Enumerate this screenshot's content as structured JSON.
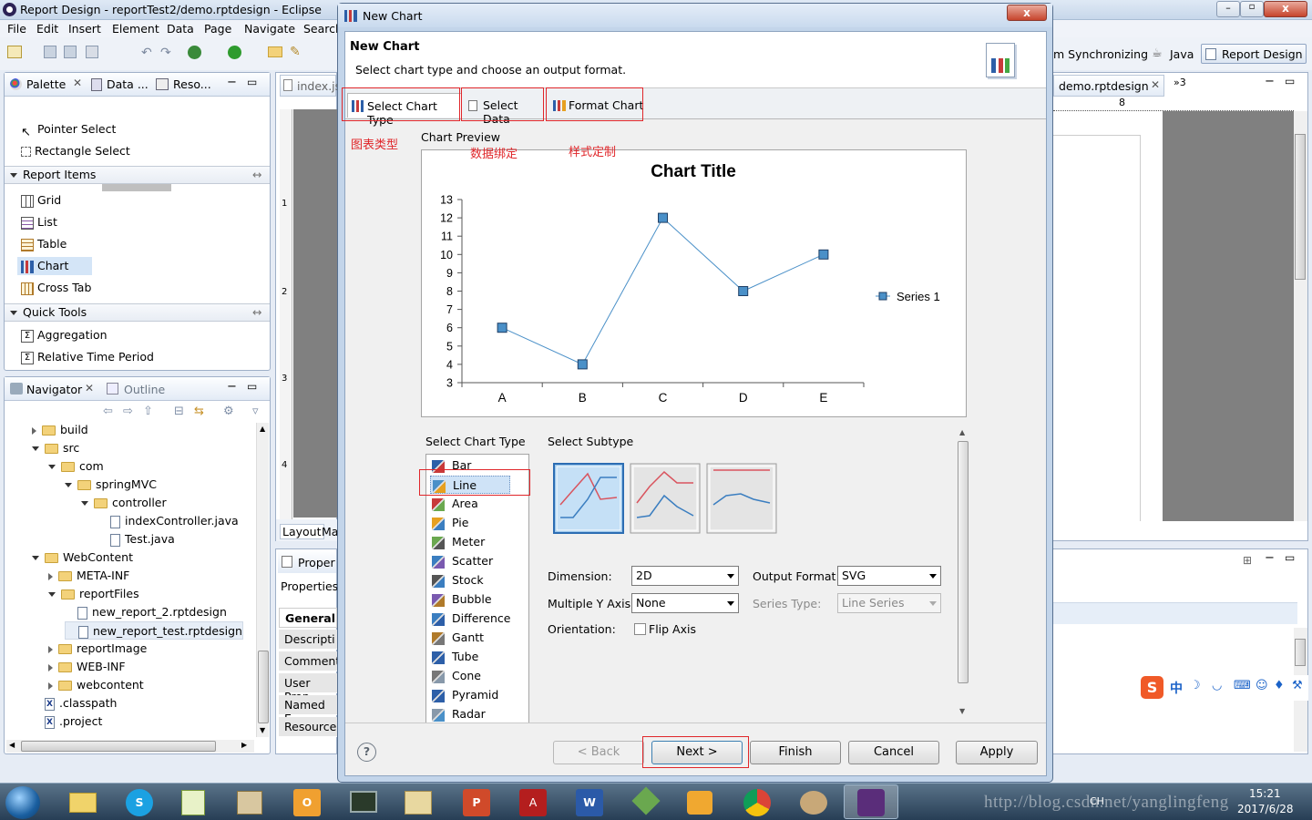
{
  "window": {
    "title": "Report Design - reportTest2/demo.rptdesign - Eclipse"
  },
  "menu": [
    "File",
    "Edit",
    "Insert",
    "Element",
    "Data",
    "Page",
    "Navigate",
    "Search"
  ],
  "perspectives": {
    "sync": "m Synchronizing",
    "java": "Java",
    "report": "Report Design"
  },
  "palette_panel": {
    "tabs": [
      "Palette",
      "Data ...",
      "Reso..."
    ],
    "tools": [
      "Pointer Select",
      "Rectangle Select"
    ],
    "report_items_header": "Report Items",
    "report_items": [
      "Grid",
      "List",
      "Table",
      "Chart",
      "Cross Tab"
    ],
    "quick_tools_header": "Quick Tools",
    "quick_tools": [
      "Aggregation",
      "Relative Time Period"
    ]
  },
  "navigator": {
    "tabs": [
      "Navigator",
      "Outline"
    ],
    "tree": [
      {
        "label": "build",
        "depth": 0,
        "type": "folder",
        "open": false
      },
      {
        "label": "src",
        "depth": 0,
        "type": "folder",
        "open": true
      },
      {
        "label": "com",
        "depth": 1,
        "type": "folder",
        "open": true
      },
      {
        "label": "springMVC",
        "depth": 2,
        "type": "folder",
        "open": true
      },
      {
        "label": "controller",
        "depth": 3,
        "type": "folder",
        "open": true
      },
      {
        "label": "indexController.java",
        "depth": 4,
        "type": "file"
      },
      {
        "label": "Test.java",
        "depth": 4,
        "type": "file"
      },
      {
        "label": "WebContent",
        "depth": 0,
        "type": "folder",
        "open": true
      },
      {
        "label": "META-INF",
        "depth": 1,
        "type": "folder",
        "open": false
      },
      {
        "label": "reportFiles",
        "depth": 1,
        "type": "folder",
        "open": true
      },
      {
        "label": "new_report_2.rptdesign",
        "depth": 2,
        "type": "file"
      },
      {
        "label": "new_report_test.rptdesign",
        "depth": 2,
        "type": "file"
      },
      {
        "label": "reportImage",
        "depth": 1,
        "type": "folder",
        "open": false
      },
      {
        "label": "WEB-INF",
        "depth": 1,
        "type": "folder",
        "open": false
      },
      {
        "label": "webcontent",
        "depth": 1,
        "type": "folder",
        "open": false
      },
      {
        "label": ".classpath",
        "depth": 0,
        "type": "xfile"
      },
      {
        "label": ".project",
        "depth": 0,
        "type": "xfile"
      }
    ]
  },
  "editor": {
    "left_tab": "index.js",
    "right_tab": "demo.rptdesign",
    "bottom_tabs": [
      "Layout",
      "Ma"
    ],
    "ruler_marks": [
      "1",
      "2",
      "3",
      "4"
    ],
    "top_ruler_mark": "8",
    "more_tabs": "»3"
  },
  "properties": {
    "tab": "Proper",
    "subtitle": "Properties",
    "items": [
      "General",
      "Descripti",
      "Comment",
      "User Prop",
      "Named E",
      "Resource"
    ]
  },
  "dialog": {
    "title": "New Chart",
    "heading": "New Chart",
    "description": "Select chart type and choose an output format.",
    "tabs": [
      "Select Chart Type",
      "Select Data",
      "Format Chart"
    ],
    "preview_label": "Chart Preview",
    "select_chart_type_label": "Select Chart Type",
    "select_subtype_label": "Select Subtype",
    "chart_types": [
      "Bar",
      "Line",
      "Area",
      "Pie",
      "Meter",
      "Scatter",
      "Stock",
      "Bubble",
      "Difference",
      "Gantt",
      "Tube",
      "Cone",
      "Pyramid",
      "Radar"
    ],
    "selected_type": "Line",
    "dimension_label": "Dimension:",
    "dimension_value": "2D",
    "output_format_label": "Output Format:",
    "output_format_value": "SVG",
    "multiple_y_label": "Multiple Y Axis:",
    "multiple_y_value": "None",
    "series_type_label": "Series Type:",
    "series_type_value": "Line Series",
    "orientation_label": "Orientation:",
    "flip_axis_label": "Flip Axis",
    "buttons": {
      "back": "< Back",
      "next": "Next >",
      "finish": "Finish",
      "cancel": "Cancel",
      "apply": "Apply"
    }
  },
  "annotations": {
    "chart_type": "图表类型",
    "data_binding": "数据绑定",
    "style_custom": "样式定制"
  },
  "ime": {
    "lang": "中"
  },
  "taskbar": {
    "time": "15:21",
    "date": "2017/6/28",
    "lang": "CH",
    "watermark": "http://blog.csdn.net/yanglingfeng"
  },
  "colors": {
    "accent_red": "#e0262a",
    "series": "#4a90c8",
    "selected_row": "#cfe3f7"
  },
  "chart_data": {
    "type": "line",
    "title": "Chart Title",
    "categories": [
      "A",
      "B",
      "C",
      "D",
      "E"
    ],
    "series": [
      {
        "name": "Series 1",
        "values": [
          6,
          4,
          12,
          8,
          10
        ]
      }
    ],
    "ylim": [
      3,
      13
    ],
    "yticks": [
      3,
      4,
      5,
      6,
      7,
      8,
      9,
      10,
      11,
      12,
      13
    ],
    "legend": "right"
  }
}
